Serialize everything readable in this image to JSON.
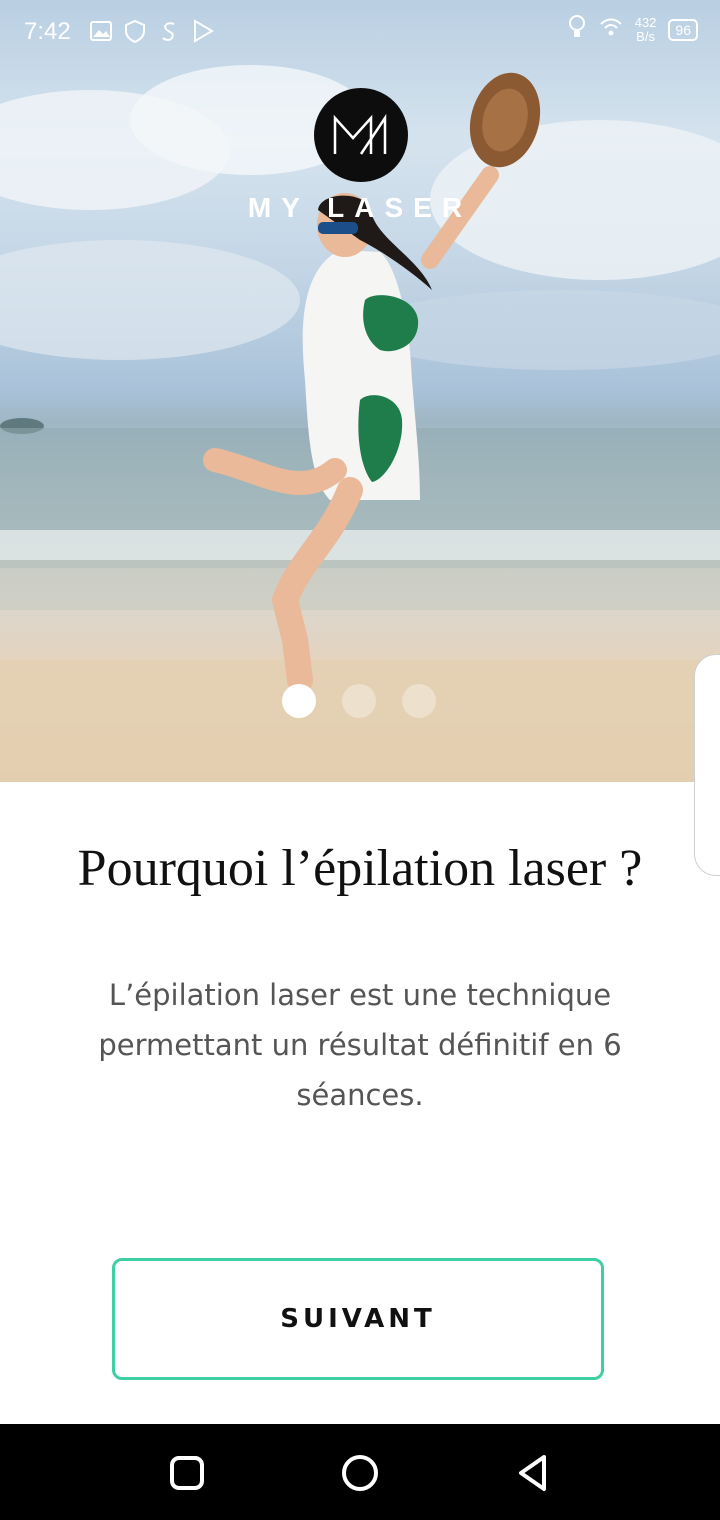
{
  "status_bar": {
    "time": "7:42",
    "net_speed_value": "432",
    "net_speed_unit": "B/s",
    "battery": "96",
    "icons": [
      "gallery-icon",
      "shield-icon",
      "s-app-icon",
      "play-store-icon",
      "bulb-icon",
      "wifi-icon"
    ]
  },
  "hero": {
    "brand_name": "MY LASER",
    "logo_icon": "ml-logo-icon"
  },
  "pagination": {
    "total": 3,
    "active_index": 0
  },
  "content": {
    "title": "Pourquoi l’épilation laser ?",
    "description": "L’épilation laser est une technique permettant un résultat définitif en 6 séances."
  },
  "actions": {
    "next_label": "SUIVANT"
  },
  "colors": {
    "accent": "#3ed0a2"
  },
  "nav_bar": {
    "icons": [
      "recent-apps-icon",
      "home-icon",
      "back-icon"
    ]
  }
}
